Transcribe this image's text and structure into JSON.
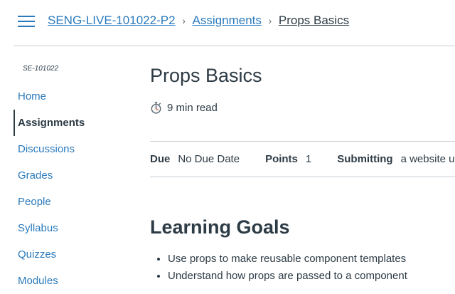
{
  "breadcrumbs": {
    "course": "SENG-LIVE-101022-P2",
    "section": "Assignments",
    "current": "Props Basics",
    "separator": "›"
  },
  "sidebar": {
    "course_code": "SE-101022",
    "items": [
      {
        "label": "Home",
        "active": false
      },
      {
        "label": "Assignments",
        "active": true
      },
      {
        "label": "Discussions",
        "active": false
      },
      {
        "label": "Grades",
        "active": false
      },
      {
        "label": "People",
        "active": false
      },
      {
        "label": "Syllabus",
        "active": false
      },
      {
        "label": "Quizzes",
        "active": false
      },
      {
        "label": "Modules",
        "active": false
      }
    ]
  },
  "assignment": {
    "title": "Props Basics",
    "read_time": "9 min read",
    "read_time_icon": "stopwatch-icon",
    "details": {
      "due_label": "Due",
      "due_value": "No Due Date",
      "points_label": "Points",
      "points_value": "1",
      "submitting_label": "Submitting",
      "submitting_value": "a website url"
    }
  },
  "content": {
    "heading": "Learning Goals",
    "goals": [
      "Use props to make reusable component templates",
      "Understand how props are passed to a component"
    ]
  },
  "colors": {
    "link": "#2b7abc",
    "text": "#2d3b45",
    "border": "#c7cdd1"
  }
}
